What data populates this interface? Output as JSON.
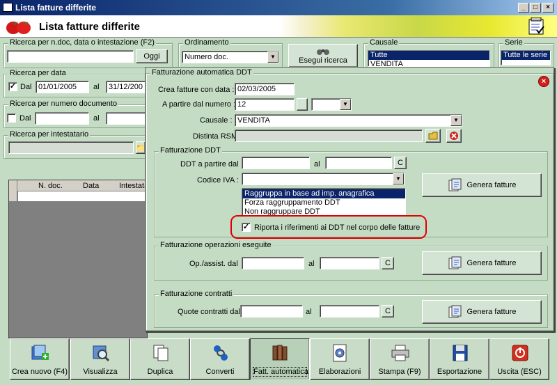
{
  "window": {
    "title": "Lista fatture differite"
  },
  "header": {
    "title": "Lista fatture differite"
  },
  "search_main": {
    "legend": "Ricerca per n.doc, data o intestazione (F2)",
    "value": "",
    "button": "Oggi"
  },
  "ordering": {
    "legend": "Ordinamento",
    "value": "Numero doc."
  },
  "execute_search": {
    "label": "Esegui ricerca"
  },
  "causale": {
    "legend": "Causale",
    "items": [
      "Tutte",
      "VENDITA"
    ]
  },
  "serie": {
    "legend": "Serie",
    "items": [
      "Tutte le serie"
    ]
  },
  "search_date": {
    "legend": "Ricerca per data",
    "from_label": "Dal",
    "from": "01/01/2005",
    "to_label": "al",
    "to": "31/12/200"
  },
  "search_number": {
    "legend": "Ricerca per numero documento",
    "from_label": "Dal",
    "to_label": "al"
  },
  "search_owner": {
    "legend": "Ricerca per intestatario"
  },
  "grid": {
    "columns": [
      "N. doc.",
      "Data",
      "Intestata"
    ]
  },
  "dialog": {
    "legend": "Fatturazione automatica DDT",
    "create_date_label": "Crea fatture con data :",
    "create_date": "02/03/2005",
    "start_number_label": "A partire dal numero :",
    "start_number": "12",
    "causale_label": "Causale :",
    "causale_value": "VENDITA",
    "distinta_label": "Distinta RSM :",
    "ddt": {
      "legend": "Fatturazione DDT",
      "from_label": "DDT a partire dal",
      "to_label": "al",
      "c_button": "C",
      "iva_label": "Codice IVA :",
      "options": [
        "Raggruppa in base ad imp. anagrafica",
        "Forza raggruppamento DDT",
        "Non raggruppare DDT"
      ],
      "checkbox_label": "Riporta i riferimenti ai DDT nel corpo delle fatture",
      "generate": "Genera fatture"
    },
    "ops": {
      "legend": "Fatturazione operazioni eseguite",
      "from_label": "Op./assist. dal",
      "to_label": "al",
      "c_button": "C",
      "generate": "Genera fatture"
    },
    "contracts": {
      "legend": "Fatturazione contratti",
      "from_label": "Quote contratti dal",
      "to_label": "al",
      "c_button": "C",
      "generate": "Genera fatture"
    }
  },
  "toolbar": {
    "items": [
      "Crea nuovo (F4)",
      "Visualizza",
      "Duplica",
      "Converti",
      "Fatt. automatica",
      "Elaborazioni",
      "Stampa (F9)",
      "Esportazione",
      "Uscita (ESC)"
    ]
  }
}
